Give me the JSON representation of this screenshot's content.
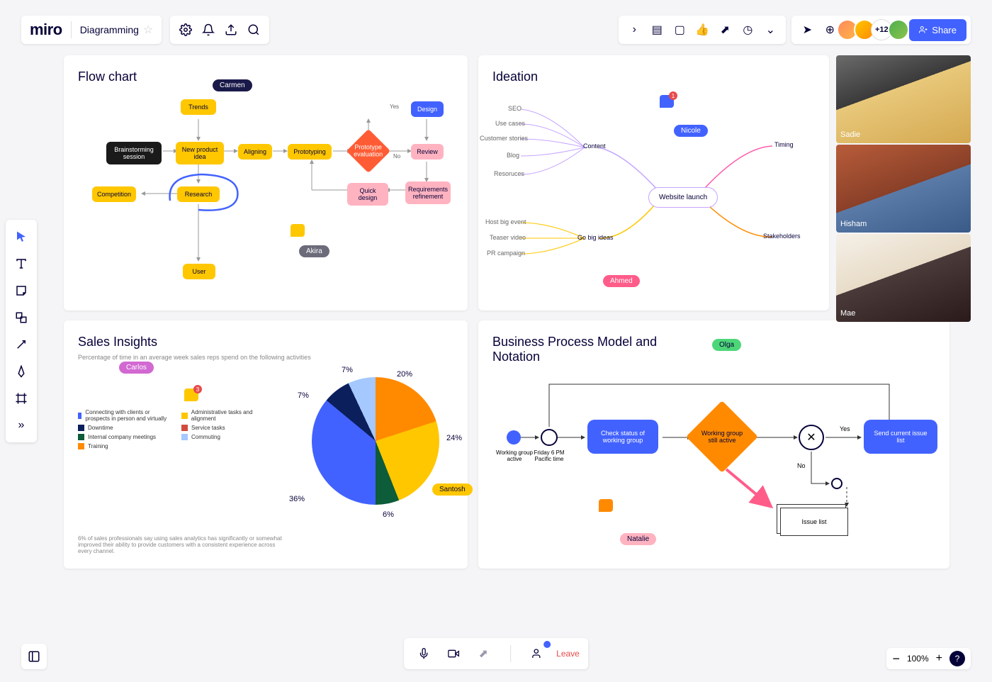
{
  "app": {
    "logo": "miro",
    "board_name": "Diagramming",
    "share_label": "Share",
    "user_count": "+12",
    "zoom": "100%",
    "leave": "Leave"
  },
  "frames": {
    "flowchart": {
      "title": "Flow chart",
      "nodes": {
        "trends": "Trends",
        "brainstorm": "Brainstorming session",
        "npi": "New product idea",
        "aligning": "Aligning",
        "prototyping": "Prototyping",
        "proto_eval": "Prototype evaluation",
        "design": "Design",
        "review": "Review",
        "quick_design": "Quick design",
        "req_refine": "Requirements refinement",
        "competition": "Competition",
        "research": "Research",
        "user": "User"
      },
      "edge_labels": {
        "yes": "Yes",
        "no": "No"
      }
    },
    "ideation": {
      "title": "Ideation",
      "center": "Website launch",
      "branches": {
        "content": "Content",
        "go_big": "Go big ideas",
        "timing": "Timing",
        "stakeholders": "Stakeholders",
        "seo": "SEO",
        "use_cases": "Use cases",
        "customer_stories": "Customer stories",
        "blog": "Blog",
        "resources": "Resoruces",
        "host_event": "Host big event",
        "teaser": "Teaser video",
        "pr": "PR campaign"
      }
    },
    "sales": {
      "title": "Sales Insights",
      "subtitle": "Percentage of time in an average week sales reps spend on the following activities",
      "footer": "6% of sales professionals say using sales analytics has significantly or somewhat improved their ability to provide customers with a consistent experience across every channel.",
      "legend": [
        {
          "label": "Connecting with clients or prospects in person and virtually",
          "color": "#4262ff"
        },
        {
          "label": "Downtime",
          "color": "#0a1f5c"
        },
        {
          "label": "Internal company meetings",
          "color": "#0d5c3a"
        },
        {
          "label": "Training",
          "color": "#ff8a00"
        },
        {
          "label": "Administrative tasks and alignment",
          "color": "#ffc700"
        },
        {
          "label": "Service tasks",
          "color": "#d14b3d"
        },
        {
          "label": "Commuting",
          "color": "#a5c8ff"
        }
      ]
    },
    "bpmn": {
      "title": "Business Process Model and Notation",
      "nodes": {
        "start": "Working group active",
        "timer": "Friday 6 PM Pacific time",
        "check": "Check status of working group",
        "gateway": "Working group still active",
        "send": "Send current issue list",
        "issue_list": "Issue list",
        "yes": "Yes",
        "no": "No"
      }
    }
  },
  "cursors": {
    "carmen": "Carmen",
    "akira": "Akira",
    "nicole": "Nicole",
    "ahmed": "Ahmed",
    "carlos": "Carlos",
    "santosh": "Santosh",
    "olga": "Olga",
    "natalie": "Natalie"
  },
  "video": {
    "p1": "Sadie",
    "p2": "Hisham",
    "p3": "Mae"
  },
  "comment_badges": {
    "ideation": "1",
    "sales": "3"
  },
  "chart_data": {
    "type": "pie",
    "title": "Sales Insights — time allocation",
    "series": [
      {
        "name": "Connecting with clients or prospects in person and virtually",
        "value": 36,
        "color": "#4262ff"
      },
      {
        "name": "Administrative tasks and alignment",
        "value": 24,
        "color": "#ffc700"
      },
      {
        "name": "Service tasks",
        "value": 20,
        "color": "#ff8a00"
      },
      {
        "name": "Commuting",
        "value": 7,
        "color": "#a5c8ff"
      },
      {
        "name": "Downtime",
        "value": 7,
        "color": "#0a1f5c"
      },
      {
        "name": "Internal company meetings",
        "value": 6,
        "color": "#0d5c3a"
      }
    ],
    "labels": [
      "36%",
      "24%",
      "20%",
      "7%",
      "7%",
      "6%"
    ]
  }
}
